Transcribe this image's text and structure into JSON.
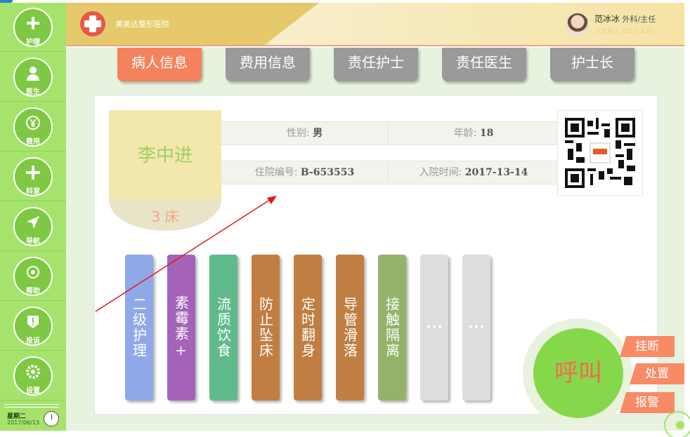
{
  "header": {
    "hospital_name": "美美达整形医院",
    "user_name": "范冰冰",
    "user_role": "外科/主任",
    "last_login": "上次登入 2017.3.20"
  },
  "sidebar": {
    "items": [
      {
        "label": "护理",
        "icon": "nursing-icon"
      },
      {
        "label": "医生",
        "icon": "doctor-icon"
      },
      {
        "label": "费用",
        "icon": "fee-icon"
      },
      {
        "label": "科室",
        "icon": "department-icon"
      },
      {
        "label": "导航",
        "icon": "navigation-icon"
      },
      {
        "label": "帮助",
        "icon": "help-icon"
      },
      {
        "label": "投诉",
        "icon": "complaint-icon"
      },
      {
        "label": "设置",
        "icon": "settings-icon"
      }
    ],
    "weekday": "星期二",
    "date": "2017/06/13"
  },
  "tabs": [
    {
      "label": "病人信息",
      "active": true
    },
    {
      "label": "费用信息",
      "active": false
    },
    {
      "label": "责任护士",
      "active": false
    },
    {
      "label": "责任医生",
      "active": false
    },
    {
      "label": "护士长",
      "active": false
    }
  ],
  "patient": {
    "name": "李中进",
    "bed": "3 床",
    "gender_label": "性别:",
    "gender": "男",
    "age_label": "年龄:",
    "age": "18",
    "admission_no_label": "住院编号:",
    "admission_no": "B-653553",
    "admission_date_label": "入院时间:",
    "admission_date": "2017-13-14"
  },
  "tags": [
    {
      "text": "二级护理",
      "color": "#8fa8e8"
    },
    {
      "text": "素霉素+",
      "color": "#a463b8"
    },
    {
      "text": "流质饮食",
      "color": "#5fba8c"
    },
    {
      "text": "防止坠床",
      "color": "#c07e42"
    },
    {
      "text": "定时翻身",
      "color": "#c07e42"
    },
    {
      "text": "导管滑落",
      "color": "#c07e42"
    },
    {
      "text": "接触隔离",
      "color": "#94b26a"
    },
    {
      "text": "•••",
      "color": "#dddddd"
    },
    {
      "text": "•••",
      "color": "#dddddd"
    }
  ],
  "call": {
    "label": "呼叫",
    "hangup": "挂断",
    "handle": "处置",
    "alarm": "报警"
  },
  "colors": {
    "sidebar": "#a6e36c",
    "active_tab": "#f4825c",
    "idle_tab": "#9a9a9a",
    "call": "#86d84b"
  }
}
